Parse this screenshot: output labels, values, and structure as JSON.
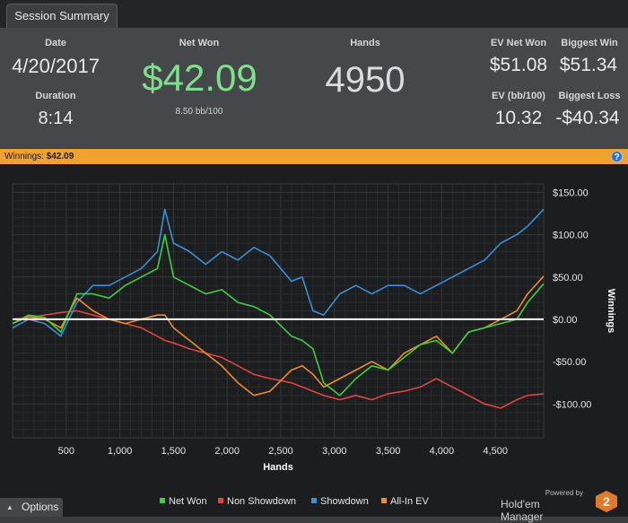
{
  "tab": {
    "label": "Session Summary"
  },
  "summary": {
    "date_label": "Date",
    "date_value": "4/20/2017",
    "duration_label": "Duration",
    "duration_value": "8:14",
    "netwon_label": "Net Won",
    "netwon_value": "$42.09",
    "netwon_sub": "8.50 bb/100",
    "hands_label": "Hands",
    "hands_value": "4950",
    "ev_net_won_label": "EV Net Won",
    "ev_net_won_value": "$51.08",
    "ev_bb_label": "EV (bb/100)",
    "ev_bb_value": "10.32",
    "biggest_win_label": "Biggest Win",
    "biggest_win_value": "$51.34",
    "biggest_loss_label": "Biggest Loss",
    "biggest_loss_value": "-$40.34"
  },
  "stripe": {
    "label": "Winnings:",
    "value": "$42.09"
  },
  "options": {
    "label": "Options"
  },
  "brand": {
    "powered_by": "Powered by",
    "name": "Hold'em Manager",
    "badge": "2"
  },
  "colors": {
    "net_won": "#3ecf3e",
    "non_showdown": "#e0443e",
    "showdown": "#3a8fd9",
    "all_in_ev": "#ef8b2c",
    "netwon_value": "#7ee08a"
  },
  "chart_data": {
    "type": "line",
    "xlabel": "Hands",
    "ylabel": "Winnings",
    "xlim": [
      0,
      4950
    ],
    "ylim": [
      -140,
      160
    ],
    "x_ticks": [
      500,
      1000,
      1500,
      2000,
      2500,
      3000,
      3500,
      4000,
      4500
    ],
    "x_tick_labels": [
      "500",
      "1,000",
      "1,500",
      "2,000",
      "2,500",
      "3,000",
      "3,500",
      "4,000",
      "4,500"
    ],
    "y_ticks": [
      150,
      100,
      50,
      0,
      -50,
      -100
    ],
    "y_tick_labels": [
      "$150.00",
      "$100.00",
      "$50.00",
      "$0.00",
      "-$50.00",
      "-$100.00"
    ],
    "grid": true,
    "legend_position": "bottom",
    "x": [
      0,
      150,
      300,
      450,
      600,
      750,
      900,
      1050,
      1200,
      1350,
      1420,
      1500,
      1650,
      1800,
      1950,
      2100,
      2250,
      2400,
      2600,
      2700,
      2800,
      2900,
      3050,
      3200,
      3350,
      3500,
      3650,
      3800,
      3950,
      4100,
      4250,
      4400,
      4550,
      4700,
      4800,
      4950
    ],
    "series": [
      {
        "name": "Net Won",
        "values": [
          -5,
          5,
          2,
          -15,
          30,
          30,
          25,
          40,
          50,
          60,
          100,
          50,
          40,
          30,
          35,
          20,
          15,
          5,
          -20,
          -25,
          -35,
          -75,
          -90,
          -70,
          -55,
          -60,
          -45,
          -30,
          -25,
          -40,
          -15,
          -10,
          -5,
          0,
          20,
          42
        ]
      },
      {
        "name": "Non Showdown",
        "values": [
          0,
          2,
          5,
          8,
          10,
          5,
          0,
          -5,
          -10,
          -20,
          -25,
          -28,
          -35,
          -40,
          -45,
          -55,
          -65,
          -70,
          -75,
          -80,
          -85,
          -90,
          -95,
          -90,
          -95,
          -88,
          -85,
          -80,
          -70,
          -80,
          -90,
          -100,
          -105,
          -95,
          -90,
          -88
        ]
      },
      {
        "name": "Showdown",
        "values": [
          -10,
          0,
          -5,
          -20,
          20,
          40,
          40,
          50,
          60,
          80,
          130,
          90,
          80,
          65,
          80,
          70,
          85,
          75,
          45,
          50,
          10,
          5,
          30,
          40,
          30,
          40,
          40,
          30,
          40,
          50,
          60,
          70,
          90,
          100,
          110,
          130
        ]
      },
      {
        "name": "All-In EV",
        "values": [
          -5,
          3,
          0,
          -10,
          25,
          10,
          0,
          -5,
          0,
          5,
          5,
          -10,
          -25,
          -40,
          -55,
          -75,
          -90,
          -85,
          -60,
          -55,
          -65,
          -80,
          -70,
          -60,
          -50,
          -60,
          -40,
          -30,
          -20,
          -40,
          -15,
          -10,
          0,
          10,
          30,
          51
        ]
      }
    ]
  }
}
